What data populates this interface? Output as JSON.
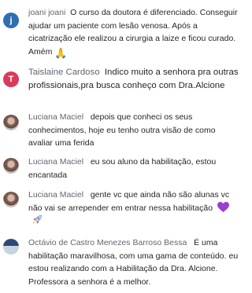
{
  "comments": [
    {
      "avatar_letter": "j",
      "avatar_color": "#2f6fb1",
      "name": "joani joani",
      "text": "O curso da doutora é diferenciado. Conseguir ajudar um paciente com lesão venosa. Após a cicatrização ele realizou a cirurgia a laize e ficou curado. Amém",
      "emoji": "praying-hands"
    },
    {
      "avatar_letter": "T",
      "avatar_color": "#d93a5b",
      "name": "Taislaine Cardoso",
      "text": "Indico muito a senhora pra outras profissionais,pra busca conheço com Dra.Alcione"
    },
    {
      "avatar_type": "photo",
      "name": "Luciana Maciel",
      "text": "depois que conheci os seus conhecimentos, hoje eu tenho outra visão de como avaliar uma ferida"
    },
    {
      "avatar_type": "photo",
      "name": "Luciana Maciel",
      "text": "eu sou aluno da habilitação, estou encantada"
    },
    {
      "avatar_type": "photo",
      "name": "Luciana Maciel",
      "text": "gente vc que ainda não são alunas vc não vai se arrepender em entrar nessa habilitação",
      "emoji": "purple-heart rocket"
    },
    {
      "avatar_type": "group-photo",
      "name": "Octávio de Castro Menezes Barroso Bessa",
      "text": "É uma habilitação maravilhosa, com uma gama de conteúdo. eu estou realizando com a Habilitação da Dra. Alcione. Professora a senhora é a melhor."
    }
  ],
  "colors": {
    "name": "#606770",
    "text": "#262626"
  }
}
